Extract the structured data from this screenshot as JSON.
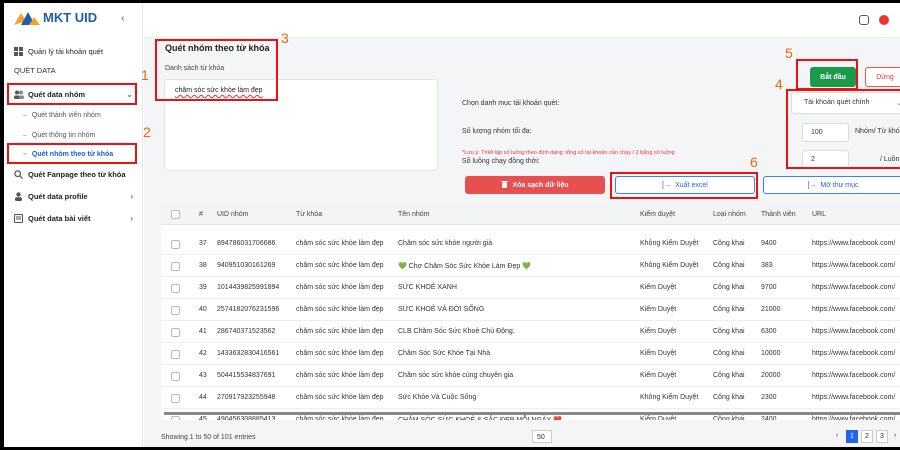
{
  "app": {
    "name": "MKT UID"
  },
  "sidebar": {
    "manage_label": "Quản lý tài khoản quét",
    "section_label": "QUÉT DATA",
    "group_label": "Quét data nhóm",
    "sub_items": [
      "Quét thành viên nhóm",
      "Quét thông tin nhóm",
      "Quét nhóm theo từ khóa"
    ],
    "fanpage_label": "Quét Fanpage theo từ khóa",
    "profile_label": "Quét data profile",
    "post_label": "Quét data bài viết"
  },
  "page": {
    "title": "Quét nhóm theo từ khóa",
    "keyword_label": "Danh sách từ khóa",
    "keyword_value": "chăm sóc sức khỏe làm đẹp"
  },
  "settings": {
    "account_category_label": "Chọn danh mục tài khoản quét:",
    "account_category_value": "Tài khoản quét chính",
    "max_groups_label": "Số lượng nhóm tối đa:",
    "max_groups_value": "100",
    "max_groups_unit": "Nhóm/ Từ khó",
    "note": "*Lưu ý: Thiết lập số luồng theo định dạng: tổng số tài khoản cần chạy / 2 bằng số luồng",
    "threads_label": "Số luồng chạy đồng thời:",
    "threads_value": "2",
    "threads_unit": "/ Luồn"
  },
  "buttons": {
    "start": "Bắt đầu",
    "stop": "Dừng",
    "clear": "Xóa sạch dữ liệu",
    "excel": "Xuất excel",
    "folder": "Mở thư mục"
  },
  "table": {
    "headers": [
      "#",
      "UID nhóm",
      "Từ khóa",
      "Tên nhóm",
      "Kiểm duyệt",
      "Loại nhóm",
      "Thành viên",
      "URL"
    ],
    "rows": [
      [
        "37",
        "894786031706686",
        "chăm sóc sức khỏe làm đẹp",
        "Chăm sóc sức khỏe người già",
        "Không Kiểm Duyệt",
        "Công khai",
        "9400",
        "https://www.facebook.com/"
      ],
      [
        "38",
        "940951030161269",
        "chăm sóc sức khỏe làm đẹp",
        "💚 Chợ Chăm Sóc Sức Khỏe Làm Đẹp 💚",
        "Không Kiểm Duyệt",
        "Công khai",
        "383",
        "https://www.facebook.com/"
      ],
      [
        "39",
        "1014439825991894",
        "chăm sóc sức khỏe làm đẹp",
        "SỨC KHOẺ XANH",
        "Kiểm Duyệt",
        "Công khai",
        "9700",
        "https://www.facebook.com/"
      ],
      [
        "40",
        "2574182076231596",
        "chăm sóc sức khỏe làm đẹp",
        "SỨC KHOẺ VÀ ĐỜI SỐNG",
        "Kiểm Duyệt",
        "Công khai",
        "21000",
        "https://www.facebook.com/"
      ],
      [
        "41",
        "286740371523562",
        "chăm sóc sức khỏe làm đẹp",
        "CLB Chăm Sóc Sức Khoẻ Chủ Động.",
        "Kiểm Duyệt",
        "Công khai",
        "6300",
        "https://www.facebook.com/"
      ],
      [
        "42",
        "1433632830416561",
        "chăm sóc sức khỏe làm đẹp",
        "Chăm Sóc Sức Khỏe Tại Nhà",
        "Kiểm Duyệt",
        "Công khai",
        "10000",
        "https://www.facebook.com/"
      ],
      [
        "43",
        "504415534837691",
        "chăm sóc sức khỏe làm đẹp",
        "Chăm sóc sức khỏe cùng chuyên gia",
        "Kiểm Duyệt",
        "Công khai",
        "20000",
        "https://www.facebook.com/"
      ],
      [
        "44",
        "270917923255948",
        "chăm sóc sức khỏe làm đẹp",
        "Sức Khỏe Và Cuộc Sống",
        "Không Kiểm Duyệt",
        "Công khai",
        "2300",
        "https://www.facebook.com/"
      ],
      [
        "45",
        "490456308885413",
        "chăm sóc sức khỏe làm đẹp",
        "CHĂM SÓC SỨC KHOẺ & SẮC ĐẸP MỖI NGÀY ❤️",
        "Kiểm Duyệt",
        "Công khai",
        "2400",
        "https://www.facebook.com/"
      ]
    ]
  },
  "footer": {
    "showing": "Showing 1 to 50 of 101 entries",
    "page_size": "50",
    "pages": [
      "‹",
      "1",
      "2",
      "3",
      "›"
    ]
  },
  "annotations": [
    "1",
    "2",
    "3",
    "4",
    "5",
    "6"
  ],
  "colors": {
    "accent": "#2563eb",
    "success": "#1a9b4b",
    "danger": "#e85050",
    "annotation": "#e11111"
  }
}
